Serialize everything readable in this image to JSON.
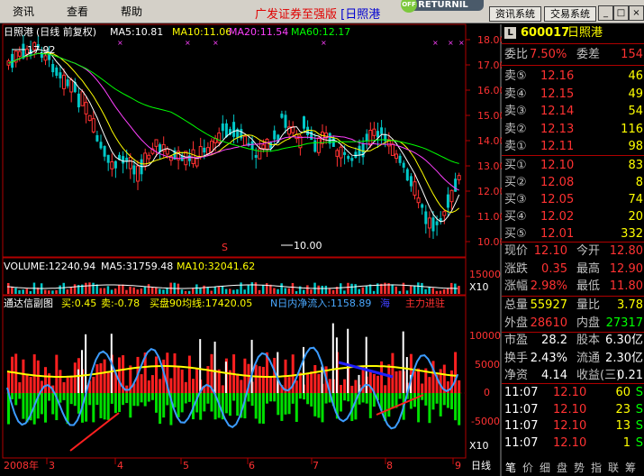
{
  "menu": {
    "items": [
      "资讯",
      "查看",
      "帮助"
    ],
    "promo_text": "广发证券至强版",
    "promo_bracket_name": "[日照港",
    "return_label": "RETURNIL",
    "return_off": "OFF",
    "sys_buttons": [
      "资讯系统",
      "交易系统"
    ],
    "win_controls": [
      "_",
      "□",
      "×"
    ]
  },
  "chart": {
    "header_name": "日照港",
    "header_type": "(日线 前复权)",
    "ma5": "MA5:10.81",
    "ma10": "MA10:11.06",
    "ma20": "MA20:11.54",
    "ma60": "MA60:12.17",
    "high_label": "17.92",
    "low_label": "10.00",
    "marker_s": "S",
    "price_ticks": [
      "18.00",
      "17.00",
      "16.00",
      "15.00",
      "14.00",
      "13.00",
      "12.00",
      "11.00",
      "10.00"
    ],
    "volume_label": "VOLUME:12240.94",
    "vol_ma5": "MA5:31759.48",
    "vol_ma10": "MA10:32041.62",
    "vol_ticks": [
      "15000",
      "X10"
    ],
    "ind_name": "通达信副图",
    "ind_buy": "买:0.45",
    "ind_sell": "卖:-0.78",
    "ind_buy90": "买盘90均线:17420.05",
    "ind_inflow": "N日内净流入:1158.89",
    "ind_sea": "海",
    "ind_main": "主力进驻",
    "ind_ticks": [
      "10000",
      "5000",
      "0",
      "-5000",
      "X10"
    ],
    "date_labels": [
      "2008年",
      "3",
      "4",
      "5",
      "6",
      "7",
      "8",
      "9"
    ],
    "date_tab": "日线",
    "colors": {
      "up": "#ff3232",
      "down": "#00c8c8",
      "ma5": "#ffffff",
      "ma10": "#ffff00",
      "ma20": "#ff40ff",
      "ma60": "#00ff00",
      "grid": "#b00000"
    }
  },
  "panel": {
    "badge": "L",
    "code": "600017",
    "name": "日照港",
    "weibi_label": "委比",
    "weibi_value": "7.50%",
    "weicha_label": "委差",
    "weicha_value": "154",
    "sell": [
      {
        "label": "卖⑤",
        "price": "12.16",
        "vol": "46"
      },
      {
        "label": "卖④",
        "price": "12.15",
        "vol": "49"
      },
      {
        "label": "卖③",
        "price": "12.14",
        "vol": "54"
      },
      {
        "label": "卖②",
        "price": "12.13",
        "vol": "116"
      },
      {
        "label": "卖①",
        "price": "12.11",
        "vol": "98"
      }
    ],
    "buy": [
      {
        "label": "买①",
        "price": "12.10",
        "vol": "83"
      },
      {
        "label": "买②",
        "price": "12.08",
        "vol": "8"
      },
      {
        "label": "买③",
        "price": "12.05",
        "vol": "74"
      },
      {
        "label": "买④",
        "price": "12.02",
        "vol": "20"
      },
      {
        "label": "买⑤",
        "price": "12.01",
        "vol": "332"
      }
    ],
    "stats": [
      {
        "l1": "现价",
        "v1": "12.10",
        "l2": "今开",
        "v2": "12.80"
      },
      {
        "l1": "涨跌",
        "v1": "0.35",
        "l2": "最高",
        "v2": "12.90"
      },
      {
        "l1": "涨幅",
        "v1": "2.98%",
        "l2": "最低",
        "v2": "11.80"
      }
    ],
    "vol_stats": [
      {
        "l1": "总量",
        "v1": "55927",
        "l2": "量比",
        "v2": "3.78"
      },
      {
        "l1": "外盘",
        "v1": "28610",
        "l2": "内盘",
        "v2": "27317"
      }
    ],
    "fin": [
      {
        "l1": "市盈",
        "v1": "28.2",
        "l2": "股本",
        "v2": "6.30亿"
      },
      {
        "l1": "换手",
        "v1": "2.43%",
        "l2": "流通",
        "v2": "2.30亿"
      },
      {
        "l1": "净资",
        "v1": "4.14",
        "l2": "收益(三)",
        "v2": "0.21"
      }
    ],
    "ticks": [
      {
        "time": "11:07",
        "price": "12.10",
        "vol": "60",
        "side": "S"
      },
      {
        "time": "11:07",
        "price": "12.10",
        "vol": "23",
        "side": "S"
      },
      {
        "time": "11:07",
        "price": "12.10",
        "vol": "13",
        "side": "S"
      },
      {
        "time": "11:07",
        "price": "12.10",
        "vol": "1",
        "side": "S"
      }
    ],
    "tabs": [
      "笔",
      "价",
      "细",
      "盘",
      "势",
      "指",
      "联",
      "筹"
    ]
  }
}
